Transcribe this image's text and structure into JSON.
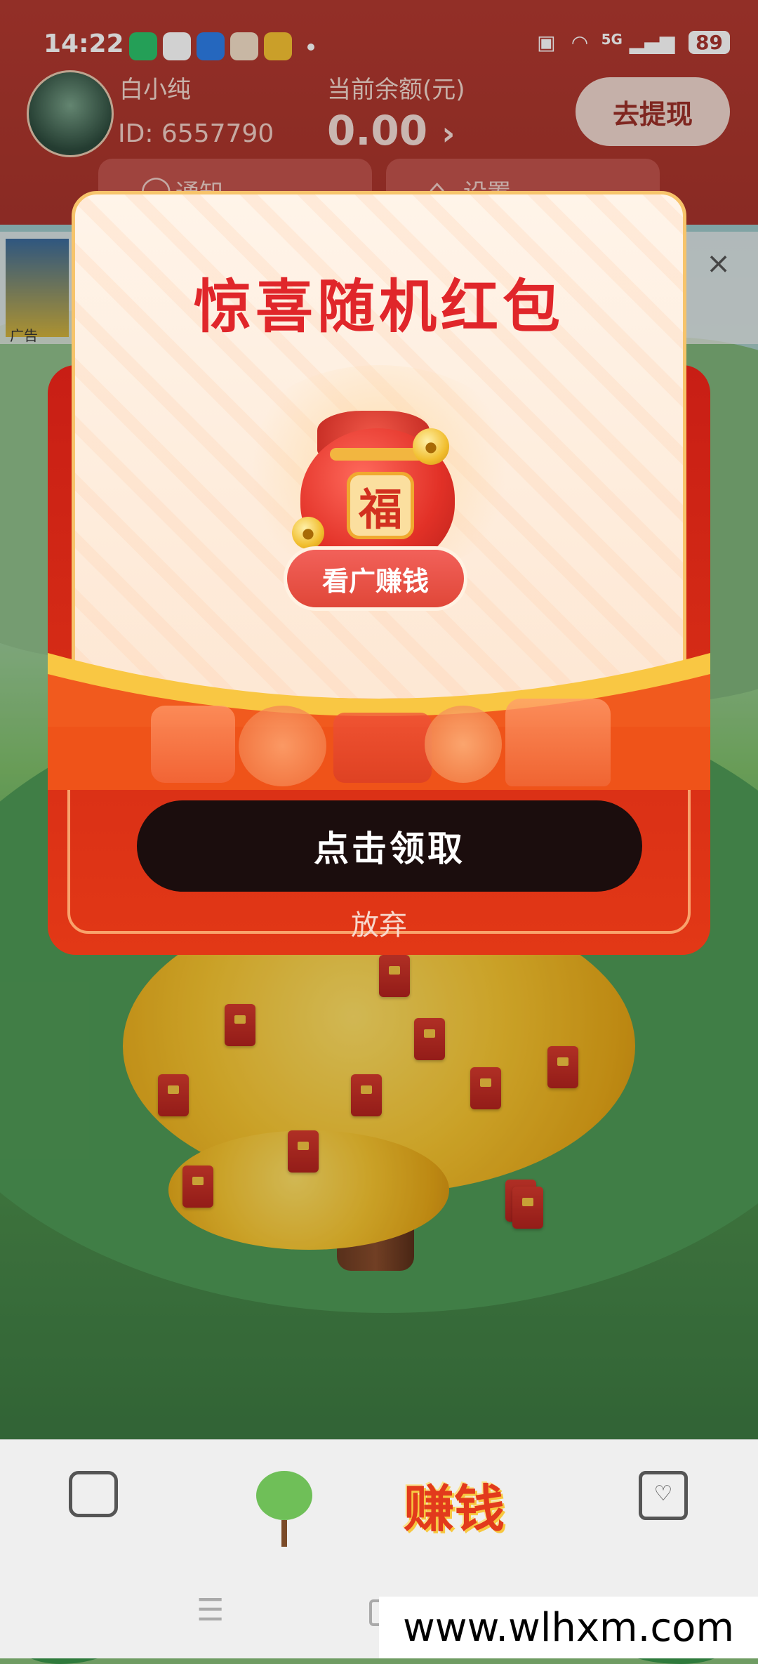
{
  "status_bar": {
    "time": "14:22",
    "network": "5G",
    "battery": "89"
  },
  "header": {
    "username": "白小纯",
    "user_id": "ID: 6557790",
    "balance_label": "当前余额(元)",
    "balance_value": "0.00",
    "withdraw_label": "去提现",
    "tabs": [
      {
        "label": "通知",
        "icon": "bell-icon"
      },
      {
        "label": "设置",
        "icon": "gear-icon"
      }
    ]
  },
  "ad_strip": {
    "snippet": "广告",
    "close_glyph": "×"
  },
  "modal": {
    "title": "惊喜随机红包",
    "bag_character": "福",
    "watch_ad_label": "看广赚钱",
    "claim_label": "点击领取",
    "abandon_label": "放弃"
  },
  "bottom_nav": {
    "items": [
      {
        "name": "home",
        "icon": "home-icon"
      },
      {
        "name": "tree",
        "icon": "tree-icon"
      },
      {
        "name": "earn",
        "label": "赚钱"
      },
      {
        "name": "mail",
        "icon": "heart-mail-icon"
      }
    ]
  },
  "watermark": "www.wlhxm.com",
  "colors": {
    "header_red": "#b33a30",
    "modal_red": "#e23816",
    "title_red": "#e0262a",
    "claim_button": "#1b0d0d"
  }
}
